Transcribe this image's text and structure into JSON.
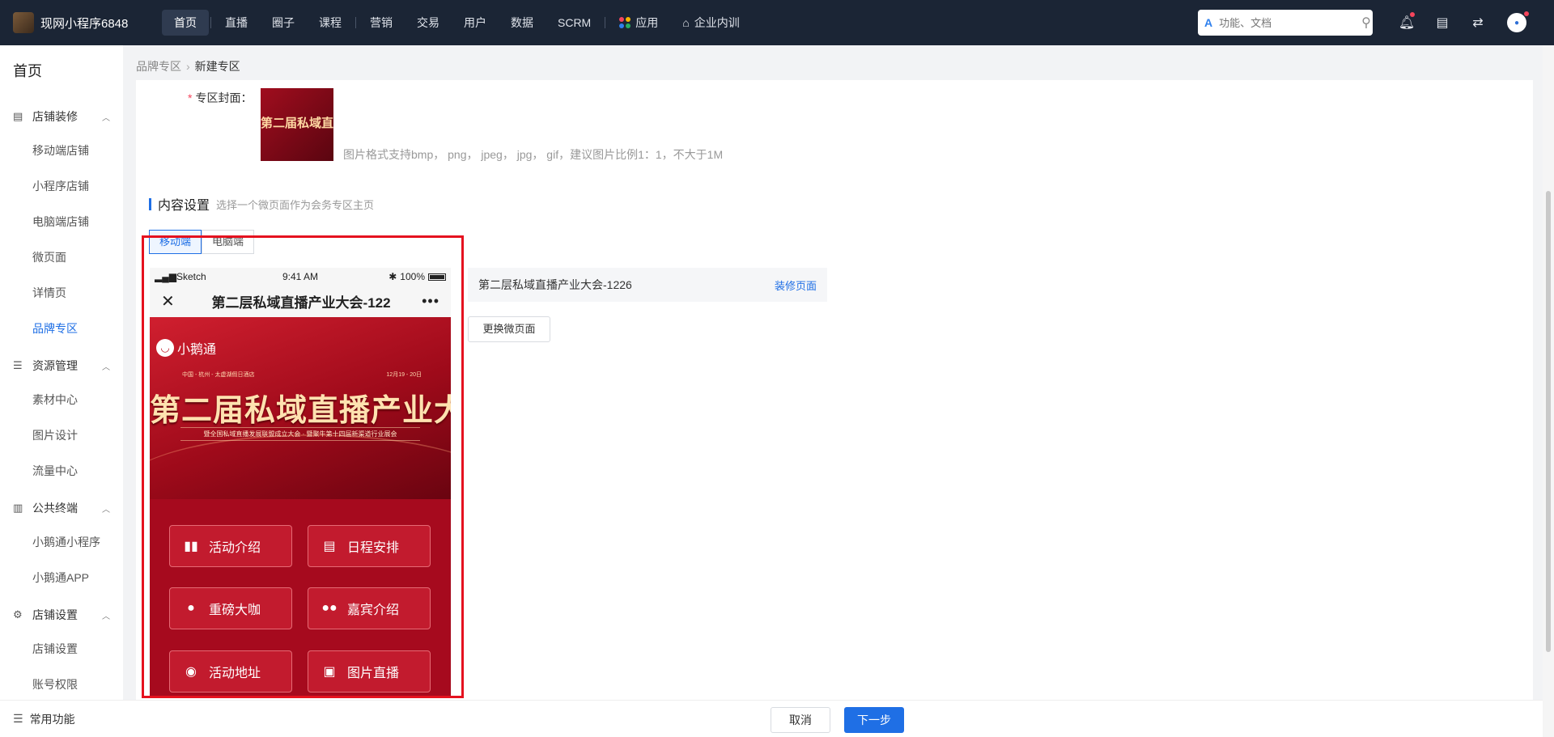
{
  "topbar": {
    "brand": "现网小程序6848",
    "nav": [
      "首页",
      "直播",
      "圈子",
      "课程",
      "营销",
      "交易",
      "用户",
      "数据",
      "SCRM"
    ],
    "app_label": "应用",
    "training_label": "企业内训",
    "search_placeholder": "功能、文档",
    "app_grid_colors": [
      "#f5455c",
      "#f7b500",
      "#2f80ed",
      "#27ae60"
    ]
  },
  "sidebar": {
    "title": "首页",
    "groups": [
      {
        "label": "店铺装修",
        "icon": "store-icon",
        "items": [
          "移动端店铺",
          "小程序店铺",
          "电脑端店铺",
          "微页面",
          "详情页",
          "品牌专区"
        ]
      },
      {
        "label": "资源管理",
        "icon": "resource-icon",
        "items": [
          "素材中心",
          "图片设计",
          "流量中心"
        ]
      },
      {
        "label": "公共终端",
        "icon": "terminal-icon",
        "items": [
          "小鹅通小程序",
          "小鹅通APP"
        ]
      },
      {
        "label": "店铺设置",
        "icon": "gear-icon",
        "items": [
          "店铺设置",
          "账号权限"
        ]
      }
    ],
    "active_item": "品牌专区",
    "bottom": "常用功能"
  },
  "breadcrumb": {
    "parent": "品牌专区",
    "current": "新建专区"
  },
  "form": {
    "cover_label": "专区封面：",
    "cover_image_text": "第二届私域直播产业",
    "cover_hint": "图片格式支持bmp， png， jpeg， jpg， gif，建议图片比例1：1，不大于1M"
  },
  "content_settings": {
    "title": "内容设置",
    "subtitle": "选择一个微页面作为会务专区主页",
    "tabs": [
      "移动端",
      "电脑端"
    ]
  },
  "phone": {
    "carrier": "Sketch",
    "time": "9:41 AM",
    "battery": "100%",
    "nav_title": "第二层私域直播产业大会-122",
    "banner_logo": "小鹅通",
    "banner_location": "中国 - 杭州 - 太虚湖假日酒店",
    "banner_date": "12月19 - 20日",
    "banner_title": "第二届私域直播产业大会",
    "banner_subtitle": "暨全国私域直播发展联盟成立大会 · 暨聚牛第十四届新渠道行业展会",
    "buttons": [
      {
        "label": "活动介绍",
        "icon": "book-icon",
        "glyph": "▮▮"
      },
      {
        "label": "日程安排",
        "icon": "calendar-icon",
        "glyph": "▤"
      },
      {
        "label": "重磅大咖",
        "icon": "person-icon",
        "glyph": "●"
      },
      {
        "label": "嘉宾介绍",
        "icon": "people-icon",
        "glyph": "●●"
      },
      {
        "label": "活动地址",
        "icon": "location-icon",
        "glyph": "◉"
      },
      {
        "label": "图片直播",
        "icon": "image-icon",
        "glyph": "▣"
      }
    ]
  },
  "selected_page": {
    "name": "第二层私域直播产业大会-1226",
    "action": "装修页面"
  },
  "change_button": "更换微页面",
  "footer": {
    "cancel": "取消",
    "next": "下一步"
  }
}
